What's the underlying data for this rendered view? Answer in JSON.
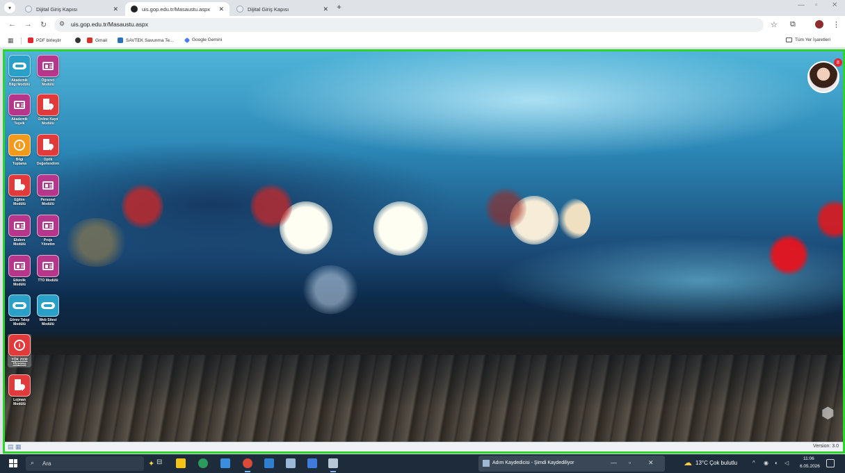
{
  "browser": {
    "tabs": [
      {
        "label": "Dijital Giriş Kapısı",
        "active": false
      },
      {
        "label": "uis.gop.edu.tr/Masaustu.aspx",
        "active": true
      },
      {
        "label": "Dijital Giriş Kapısı",
        "active": false
      }
    ],
    "address": "uis.gop.edu.tr/Masaustu.aspx",
    "bookmarks": [
      {
        "label": "PDF birleştir",
        "color": "#e3262f"
      },
      {
        "label": "",
        "color": "#333333"
      },
      {
        "label": "Gmail",
        "color": "#d93025"
      },
      {
        "label": "SAVTEK Savunma Te...",
        "color": "#2a6fb8"
      },
      {
        "label": "Google Gemini",
        "color": "#4a7df3"
      }
    ],
    "all_bookmarks": "Tüm Yer İşaretleri"
  },
  "desktop": {
    "notification_count": "8",
    "modules": [
      {
        "label": "Akademik\nBilgi Modülü",
        "icon": "cloud-icon",
        "color": "#2a9fc7"
      },
      {
        "label": "Öğrenci\nModülü",
        "icon": "id-card-icon",
        "color": "#b5368a"
      },
      {
        "label": "Akademik\nTeşvik",
        "icon": "id-card-icon",
        "color": "#b5368a"
      },
      {
        "label": "Online Kayıt\nModülü",
        "icon": "building-pin-icon",
        "color": "#e03a3a"
      },
      {
        "label": "Bilgi\nToplama",
        "icon": "info-pin-icon",
        "color": "#f29a1c"
      },
      {
        "label": "Optik\nDeğerlendirm",
        "icon": "building-pin-icon",
        "color": "#e03a3a"
      },
      {
        "label": "Eğitim\nModülü",
        "icon": "building-pin-icon",
        "color": "#e03a3a"
      },
      {
        "label": "Personel\nModülü",
        "icon": "id-card-icon",
        "color": "#b5368a"
      },
      {
        "label": "Ekders\nModülü",
        "icon": "id-card-icon",
        "color": "#b5368a"
      },
      {
        "label": "Proje\nYönetim",
        "icon": "id-card-icon",
        "color": "#b5368a"
      },
      {
        "label": "Etkinlik\nModülü",
        "icon": "id-card-icon",
        "color": "#b5368a"
      },
      {
        "label": "TTO Modülü",
        "icon": "id-card-icon",
        "color": "#b5368a"
      },
      {
        "label": "Görev Talep\nModülü",
        "icon": "cloud-icon",
        "color": "#2a9fc7"
      },
      {
        "label": "Web Sitesi\nModülü",
        "icon": "cloud-icon",
        "color": "#2a9fc7"
      },
      {
        "label": "YÖK 2030\nVizyonu",
        "icon": "building-info-icon",
        "color": "#e03a3a"
      },
      {
        "label": "Lojman\nModülü",
        "icon": "building-pin-icon",
        "color": "#e03a3a"
      }
    ],
    "version": "Version: 3.0"
  },
  "taskbar": {
    "search_placeholder": "Ara",
    "window_title": "Adım Kaydedicisi - Şimdi Kaydediliyor",
    "weather": "13°C Çok bulutlu",
    "time": "11:06",
    "date": "6.05.2026"
  }
}
